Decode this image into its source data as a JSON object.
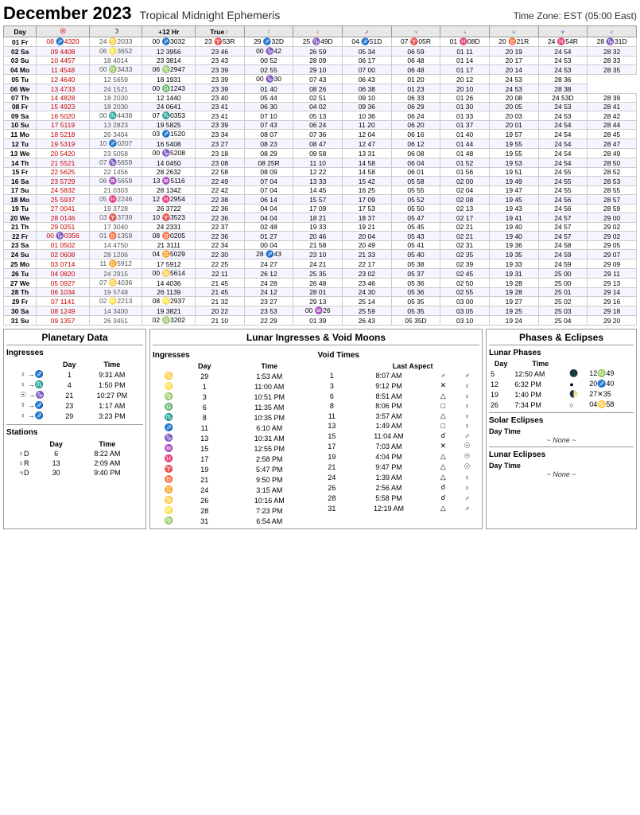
{
  "header": {
    "title": "December 2023",
    "subtitle": "Tropical Midnight Ephemeris",
    "timezone": "Time Zone: EST  (05:00 East)"
  },
  "columns": [
    "Day",
    "☉",
    "☽",
    "+12 Hr",
    "True♀",
    "☿",
    "♀",
    "♂",
    "♃",
    "♄",
    "♅",
    "♆",
    "♇"
  ],
  "rows": [
    {
      "day": "01 Fr",
      "sun": "08 ♐43 20",
      "moon": "24 ♋20 33",
      "hr12": "00 ♐30 32",
      "trueNode": "23 ♈53 R",
      "mercury": "29 ♐32 D",
      "venus": "25 ♑49 D",
      "mars": "04 ♐51 D",
      "jupiter": "07 ♈05 R",
      "saturn": "01 ♓08 D",
      "uranus": "20 ♉21 R",
      "neptune": "24 ♓54 R",
      "pluto": "28 ♑31 D"
    },
    {
      "day": "02 Sa",
      "sun": "09",
      "moon": "",
      "hr12": "12  39 56",
      "trueNode": "23",
      "mercury": "",
      "venus": "26  59",
      "mars": "05  34",
      "jupiter": "06  59",
      "saturn": "01  11",
      "uranus": "20  19",
      "neptune": "24  54",
      "pluto": "28  32"
    },
    {
      "day": "03 Su",
      "sun": "10",
      "moon": "",
      "hr12": "",
      "trueNode": "23",
      "mercury": "",
      "venus": "28  09",
      "mars": "06  17",
      "jupiter": "06  48",
      "saturn": "01  14",
      "uranus": "20  17",
      "neptune": "24  53",
      "pluto": "28  33"
    },
    {
      "day": "04 Mo",
      "sun": "11",
      "moon": "",
      "hr12": "",
      "trueNode": "23",
      "mercury": "",
      "venus": "29  10",
      "mars": "07  00",
      "jupiter": "06  48",
      "saturn": "01  17",
      "uranus": "20  14",
      "neptune": "24  53",
      "pluto": "28  35"
    },
    {
      "day": "05 Tu",
      "sun": "12",
      "moon": "",
      "hr12": "",
      "trueNode": "23",
      "mercury": "",
      "venus": "00 ♑30",
      "mars": "07  43",
      "jupiter": "06  43",
      "saturn": "01  20",
      "uranus": "20  12",
      "neptune": "24  53",
      "pluto": "28  36"
    },
    {
      "day": "06 We",
      "sun": "13",
      "moon": "",
      "hr12": "",
      "trueNode": "23",
      "mercury": "",
      "venus": "01  40",
      "mars": "08  26",
      "jupiter": "06  38",
      "saturn": "01  23",
      "uranus": "20  10",
      "neptune": "24  53",
      "pluto": "28  38"
    },
    {
      "day": "07 Th",
      "sun": "14",
      "moon": "",
      "hr12": "",
      "trueNode": "23",
      "mercury": "",
      "venus": "02  51",
      "mars": "09  10",
      "jupiter": "06  33",
      "saturn": "01  26",
      "uranus": "20  08",
      "neptune": "24  53 D",
      "pluto": "28  39"
    },
    {
      "day": "08 Fr",
      "sun": "15",
      "moon": "",
      "hr12": "",
      "trueNode": "23",
      "mercury": "",
      "venus": "04  02",
      "mars": "09  36",
      "jupiter": "06  29",
      "saturn": "01  30",
      "uranus": "20  05",
      "neptune": "24  53",
      "pluto": "28  41"
    },
    {
      "day": "09 Sa",
      "sun": "16",
      "moon": "",
      "hr12": "",
      "trueNode": "23",
      "mercury": "",
      "venus": "05  13",
      "mars": "10  36",
      "jupiter": "06  24",
      "saturn": "01  33",
      "uranus": "20  03",
      "neptune": "24  53",
      "pluto": "28  42"
    },
    {
      "day": "10 Su",
      "sun": "17",
      "moon": "",
      "hr12": "",
      "trueNode": "23",
      "mercury": "",
      "venus": "06  24",
      "mars": "11  20",
      "jupiter": "06  20",
      "saturn": "01  37",
      "uranus": "20  01",
      "neptune": "24  54",
      "pluto": "28  44"
    },
    {
      "day": "11 Mo",
      "sun": "18",
      "moon": "",
      "hr12": "",
      "trueNode": "23",
      "mercury": "",
      "venus": "07  36",
      "mars": "12  04",
      "jupiter": "06  16",
      "saturn": "01  40",
      "uranus": "19  57",
      "neptune": "24  54",
      "pluto": "28  45"
    },
    {
      "day": "12 Tu",
      "sun": "19",
      "moon": "",
      "hr12": "",
      "trueNode": "23",
      "mercury": "",
      "venus": "08  47",
      "mars": "12  47",
      "jupiter": "06  12",
      "saturn": "01  44",
      "uranus": "19  55",
      "neptune": "24  54",
      "pluto": "28  47"
    },
    {
      "day": "13 We",
      "sun": "20",
      "moon": "",
      "hr12": "",
      "trueNode": "23",
      "mercury": "",
      "venus": "09  58",
      "mars": "13  31",
      "jupiter": "06  08",
      "saturn": "01  48",
      "uranus": "19  55",
      "neptune": "24  54",
      "pluto": "28  49"
    },
    {
      "day": "14 Th",
      "sun": "21",
      "moon": "",
      "hr12": "",
      "trueNode": "23",
      "mercury": "",
      "venus": "11  10",
      "mars": "14  58",
      "jupiter": "06  04",
      "saturn": "01  52",
      "uranus": "19  53",
      "neptune": "24  54",
      "pluto": "28  50"
    },
    {
      "day": "15 Fr",
      "sun": "22",
      "moon": "",
      "hr12": "",
      "trueNode": "22",
      "mercury": "",
      "venus": "12  22",
      "mars": "14  58",
      "jupiter": "06  01",
      "saturn": "01  56",
      "uranus": "19  51",
      "neptune": "24  55",
      "pluto": "28  52"
    },
    {
      "day": "16 Sa",
      "sun": "23",
      "moon": "",
      "hr12": "",
      "trueNode": "22",
      "mercury": "",
      "venus": "13  33",
      "mars": "15  42",
      "jupiter": "05  58",
      "saturn": "02  00",
      "uranus": "19  49",
      "neptune": "24  55",
      "pluto": "28  53"
    },
    {
      "day": "17 Su",
      "sun": "24",
      "moon": "",
      "hr12": "",
      "trueNode": "22",
      "mercury": "",
      "venus": "14  45",
      "mars": "16  25",
      "jupiter": "05  55",
      "saturn": "02  04",
      "uranus": "19  47",
      "neptune": "24  55",
      "pluto": "28  55"
    },
    {
      "day": "18 Mo",
      "sun": "25",
      "moon": "",
      "hr12": "",
      "trueNode": "22",
      "mercury": "",
      "venus": "15  57",
      "mars": "17  09",
      "jupiter": "05  52",
      "saturn": "02  08",
      "uranus": "19  45",
      "neptune": "24  56",
      "pluto": "28  57"
    },
    {
      "day": "19 Tu",
      "sun": "26",
      "moon": "",
      "hr12": "",
      "trueNode": "22",
      "mercury": "",
      "venus": "17  09",
      "mars": "17  53",
      "jupiter": "05  50",
      "saturn": "02  13",
      "uranus": "19  43",
      "neptune": "24  56",
      "pluto": "28  59"
    },
    {
      "day": "20 We",
      "sun": "27",
      "moon": "",
      "hr12": "",
      "trueNode": "22",
      "mercury": "",
      "venus": "18  21",
      "mars": "18  37",
      "jupiter": "05  47",
      "saturn": "02  17",
      "uranus": "19  41",
      "neptune": "24  57",
      "pluto": "29  00"
    },
    {
      "day": "21 Th",
      "sun": "29",
      "moon": "",
      "hr12": "",
      "trueNode": "22",
      "mercury": "",
      "venus": "19  33",
      "mars": "19  21",
      "jupiter": "05  45",
      "saturn": "02  21",
      "uranus": "19  40",
      "neptune": "24  57",
      "pluto": "29  02"
    },
    {
      "day": "22 Fr",
      "sun": "00 ♑03",
      "moon": "",
      "hr12": "",
      "trueNode": "22",
      "mercury": "",
      "venus": "20  46",
      "mars": "20  04",
      "jupiter": "05  43",
      "saturn": "02  21",
      "uranus": "19  40",
      "neptune": "24  57",
      "pluto": "29  02"
    },
    {
      "day": "23 Sa",
      "sun": "01",
      "moon": "",
      "hr12": "",
      "trueNode": "22",
      "mercury": "",
      "venus": "21  58",
      "mars": "20  49",
      "jupiter": "05  41",
      "saturn": "02  31",
      "uranus": "19  36",
      "neptune": "24  58",
      "pluto": "29  05"
    },
    {
      "day": "24 Su",
      "sun": "02",
      "moon": "",
      "hr12": "",
      "trueNode": "22",
      "mercury": "",
      "venus": "23  10",
      "mars": "21  33",
      "jupiter": "05  40",
      "saturn": "02  35",
      "uranus": "19  35",
      "neptune": "24  59",
      "pluto": "29  07"
    },
    {
      "day": "25 Mo",
      "sun": "03",
      "moon": "",
      "hr12": "",
      "trueNode": "22",
      "mercury": "",
      "venus": "24  21",
      "mars": "22  17",
      "jupiter": "05  38",
      "saturn": "02  39",
      "uranus": "19  33",
      "neptune": "24  59",
      "pluto": "29  09"
    },
    {
      "day": "26 Tu",
      "sun": "04",
      "moon": "",
      "hr12": "",
      "trueNode": "22",
      "mercury": "",
      "venus": "25  35",
      "mars": "23  02",
      "jupiter": "05  37",
      "saturn": "02  45",
      "uranus": "19  31",
      "neptune": "25  00",
      "pluto": "29  11"
    },
    {
      "day": "27 We",
      "sun": "05",
      "moon": "",
      "hr12": "",
      "trueNode": "21",
      "mercury": "",
      "venus": "26  48",
      "mars": "23  46",
      "jupiter": "05  36",
      "saturn": "02  50",
      "uranus": "19  28",
      "neptune": "25  00",
      "pluto": "29  13"
    },
    {
      "day": "28 Th",
      "sun": "06",
      "moon": "",
      "hr12": "",
      "trueNode": "21",
      "mercury": "",
      "venus": "28  01",
      "mars": "24  30",
      "jupiter": "05  36",
      "saturn": "02  55",
      "uranus": "19  28",
      "neptune": "25  01",
      "pluto": "29  14"
    },
    {
      "day": "29 Fr",
      "sun": "07",
      "moon": "",
      "hr12": "",
      "trueNode": "21",
      "mercury": "",
      "venus": "29  13",
      "mars": "25  14",
      "jupiter": "05  35",
      "saturn": "03  00",
      "uranus": "19  27",
      "neptune": "25  02",
      "pluto": "29  16"
    },
    {
      "day": "30 Sa",
      "sun": "08",
      "moon": "",
      "hr12": "",
      "trueNode": "21",
      "mercury": "",
      "venus": "00 ♒26",
      "mars": "25  59",
      "jupiter": "05  35",
      "saturn": "03  05",
      "uranus": "19  25",
      "neptune": "25  03",
      "pluto": "29  18"
    },
    {
      "day": "31 Su",
      "sun": "09",
      "moon": "",
      "hr12": "",
      "trueNode": "21",
      "mercury": "",
      "venus": "01  39",
      "mars": "26  43",
      "jupiter": "05  35 D",
      "saturn": "03  10",
      "uranus": "19  24",
      "neptune": "25  04",
      "pluto": "29  20"
    }
  ],
  "planetary_data": {
    "title": "Planetary Data",
    "ingresses_title": "Ingresses",
    "ingresses_headers": [
      "",
      "Day",
      "Time"
    ],
    "ingresses": [
      {
        "planet": "♀",
        "sign": "♐",
        "day": "1",
        "time": "9:31 AM"
      },
      {
        "planet": "♀",
        "sign": "♏",
        "day": "4",
        "time": "1:50 PM"
      },
      {
        "planet": "☉",
        "sign": "♑",
        "day": "21",
        "time": "10:27 PM"
      },
      {
        "planet": "☿",
        "sign": "♐",
        "day": "23",
        "time": "1:17 AM"
      },
      {
        "planet": "♀",
        "sign": "♐",
        "day": "29",
        "time": "3:23 PM"
      }
    ],
    "stations_title": "Stations",
    "stations_headers": [
      "",
      "Day",
      "Time"
    ],
    "stations": [
      {
        "planet": "♀D",
        "day": "6",
        "time": "8:22 AM"
      },
      {
        "planet": "♀R",
        "day": "13",
        "time": "2:09 AM"
      },
      {
        "planet": "♃D",
        "day": "30",
        "time": "9:40 PM"
      }
    ]
  },
  "lunar_ingresses": {
    "title": "Lunar Ingresses & Void Moons",
    "ingresses_title": "Ingresses",
    "ingresses_headers": [
      "",
      "Day",
      "Time"
    ],
    "ingresses": [
      {
        "sign": "♋",
        "day": "29",
        "time": "1:53 AM"
      },
      {
        "sign": "♌",
        "day": "1",
        "time": "11:00 AM"
      },
      {
        "sign": "♍",
        "day": "3",
        "time": "10:51 PM"
      },
      {
        "sign": "♎",
        "day": "6",
        "time": "11:35 AM"
      },
      {
        "sign": "♏",
        "day": "8",
        "time": "10:35 PM"
      },
      {
        "sign": "♐",
        "day": "11",
        "time": "6:10 AM"
      },
      {
        "sign": "♑",
        "day": "13",
        "time": "10:31 AM"
      },
      {
        "sign": "♒",
        "day": "15",
        "time": "12:55 PM"
      },
      {
        "sign": "♓",
        "day": "17",
        "time": "2:58 PM"
      },
      {
        "sign": "♈",
        "day": "19",
        "time": "5:47 PM"
      },
      {
        "sign": "♉",
        "day": "21",
        "time": "9:50 PM"
      },
      {
        "sign": "♊",
        "day": "24",
        "time": "3:15 AM"
      },
      {
        "sign": "♋",
        "day": "26",
        "time": "10:16 AM"
      },
      {
        "sign": "♌",
        "day": "28",
        "time": "7:23 PM"
      },
      {
        "sign": "♍",
        "day": "31",
        "time": "6:54 AM"
      }
    ],
    "void_title": "Void Times",
    "void_headers": [
      "",
      "Last Aspect"
    ],
    "voids": [
      {
        "day": "1",
        "time": "8:07 AM",
        "aspect": "♂",
        "planet": "♂"
      },
      {
        "day": "3",
        "time": "9:12 PM",
        "aspect": "✕",
        "planet": "♀"
      },
      {
        "day": "6",
        "time": "8:51 AM",
        "aspect": "△",
        "planet": "♀"
      },
      {
        "day": "8",
        "time": "8:06 PM",
        "aspect": "□",
        "planet": "♀"
      },
      {
        "day": "11",
        "time": "3:57 AM",
        "aspect": "△",
        "planet": "♀"
      },
      {
        "day": "13",
        "time": "1:49 AM",
        "aspect": "□",
        "planet": "♀"
      },
      {
        "day": "15",
        "time": "11:04 AM",
        "aspect": "☌",
        "planet": "♂"
      },
      {
        "day": "17",
        "time": "7:03 AM",
        "aspect": "✕",
        "planet": "☉"
      },
      {
        "day": "19",
        "time": "4:04 PM",
        "aspect": "△",
        "planet": "☉"
      },
      {
        "day": "21",
        "time": "9:47 PM",
        "aspect": "△",
        "planet": "☉"
      },
      {
        "day": "24",
        "time": "1:39 AM",
        "aspect": "△",
        "planet": "♀"
      },
      {
        "day": "26",
        "time": "2:56 AM",
        "aspect": "☌",
        "planet": "♀"
      },
      {
        "day": "28",
        "time": "5:58 PM",
        "aspect": "☌",
        "planet": "♂"
      },
      {
        "day": "31",
        "time": "12:19 AM",
        "aspect": "△",
        "planet": "♂"
      }
    ]
  },
  "phases_eclipses": {
    "title": "Phases & Eclipses",
    "lunar_phases_title": "Lunar Phases",
    "phases_headers": [
      "Day",
      "Time"
    ],
    "phases": [
      {
        "day": "5",
        "time": "12:50 AM",
        "symbol": "🌑",
        "degree": "12♍49"
      },
      {
        "day": "12",
        "time": "6:32 PM",
        "symbol": "●",
        "degree": "20♐40"
      },
      {
        "day": "19",
        "time": "1:40 PM",
        "symbol": "🌓",
        "degree": "27✕35"
      },
      {
        "day": "26",
        "time": "7:34 PM",
        "symbol": "○",
        "degree": "04♋58"
      }
    ],
    "solar_eclipses_title": "Solar Eclipses",
    "solar_eclipses_day_time": "Day  Time",
    "solar_none": "~ None ~",
    "lunar_eclipses_title": "Lunar Eclipses",
    "lunar_eclipses_day_time": "Day  Time",
    "lunar_none": "~ None ~"
  }
}
